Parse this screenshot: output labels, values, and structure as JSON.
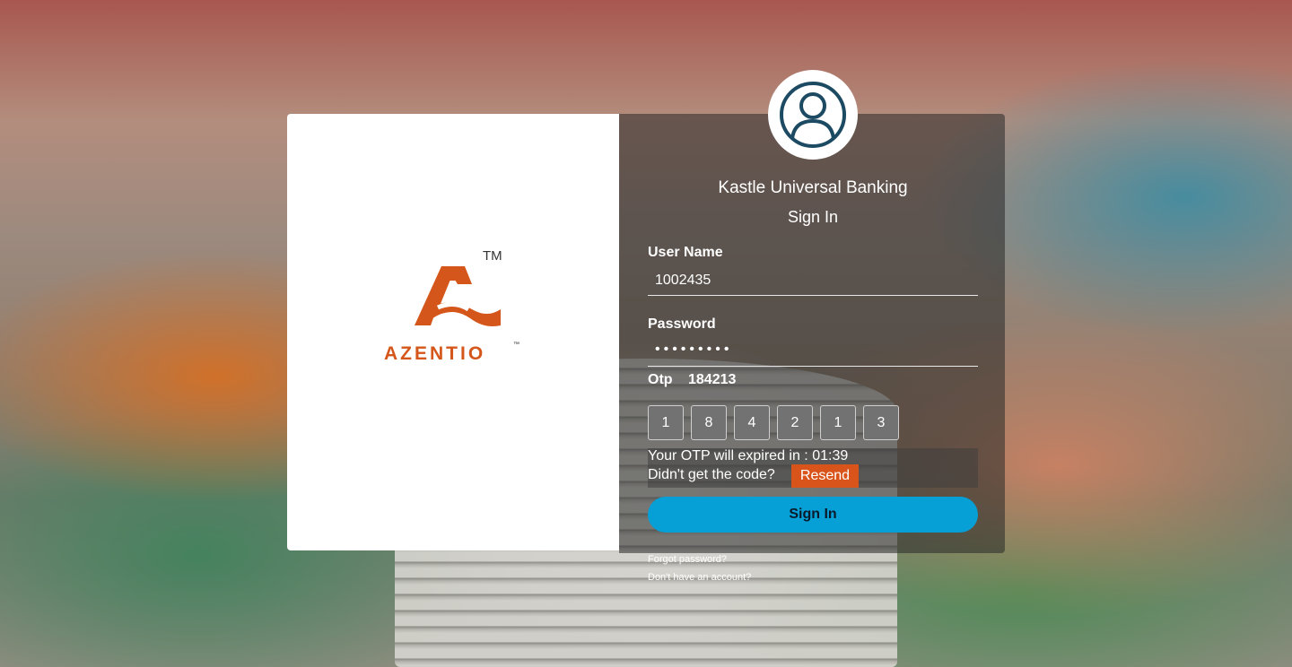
{
  "brand": {
    "logo_text": "AZENTIO",
    "trademark": "TM",
    "trademark_small": "™",
    "accent_color": "#d4561a"
  },
  "header": {
    "bank_name": "Kastle Universal Banking",
    "form_title": "Sign In",
    "avatar_icon": "user-avatar-icon"
  },
  "form": {
    "username_label": "User Name",
    "username_value": "1002435",
    "password_label": "Password",
    "password_value": "•••••••••",
    "otp_label": "Otp",
    "otp_value": "184213",
    "otp_digits": [
      "1",
      "8",
      "4",
      "2",
      "1",
      "3"
    ],
    "otp_expiry_text": "Your OTP will expired in : 01:39",
    "no_code_text": "Didn't get the code?",
    "resend_label": "Resend",
    "signin_label": "Sign In",
    "signin_color": "#069fd6",
    "resend_color": "#d9541a"
  },
  "links": {
    "forgot_password": "Forgot password?",
    "no_account": "Don't have an account?"
  }
}
